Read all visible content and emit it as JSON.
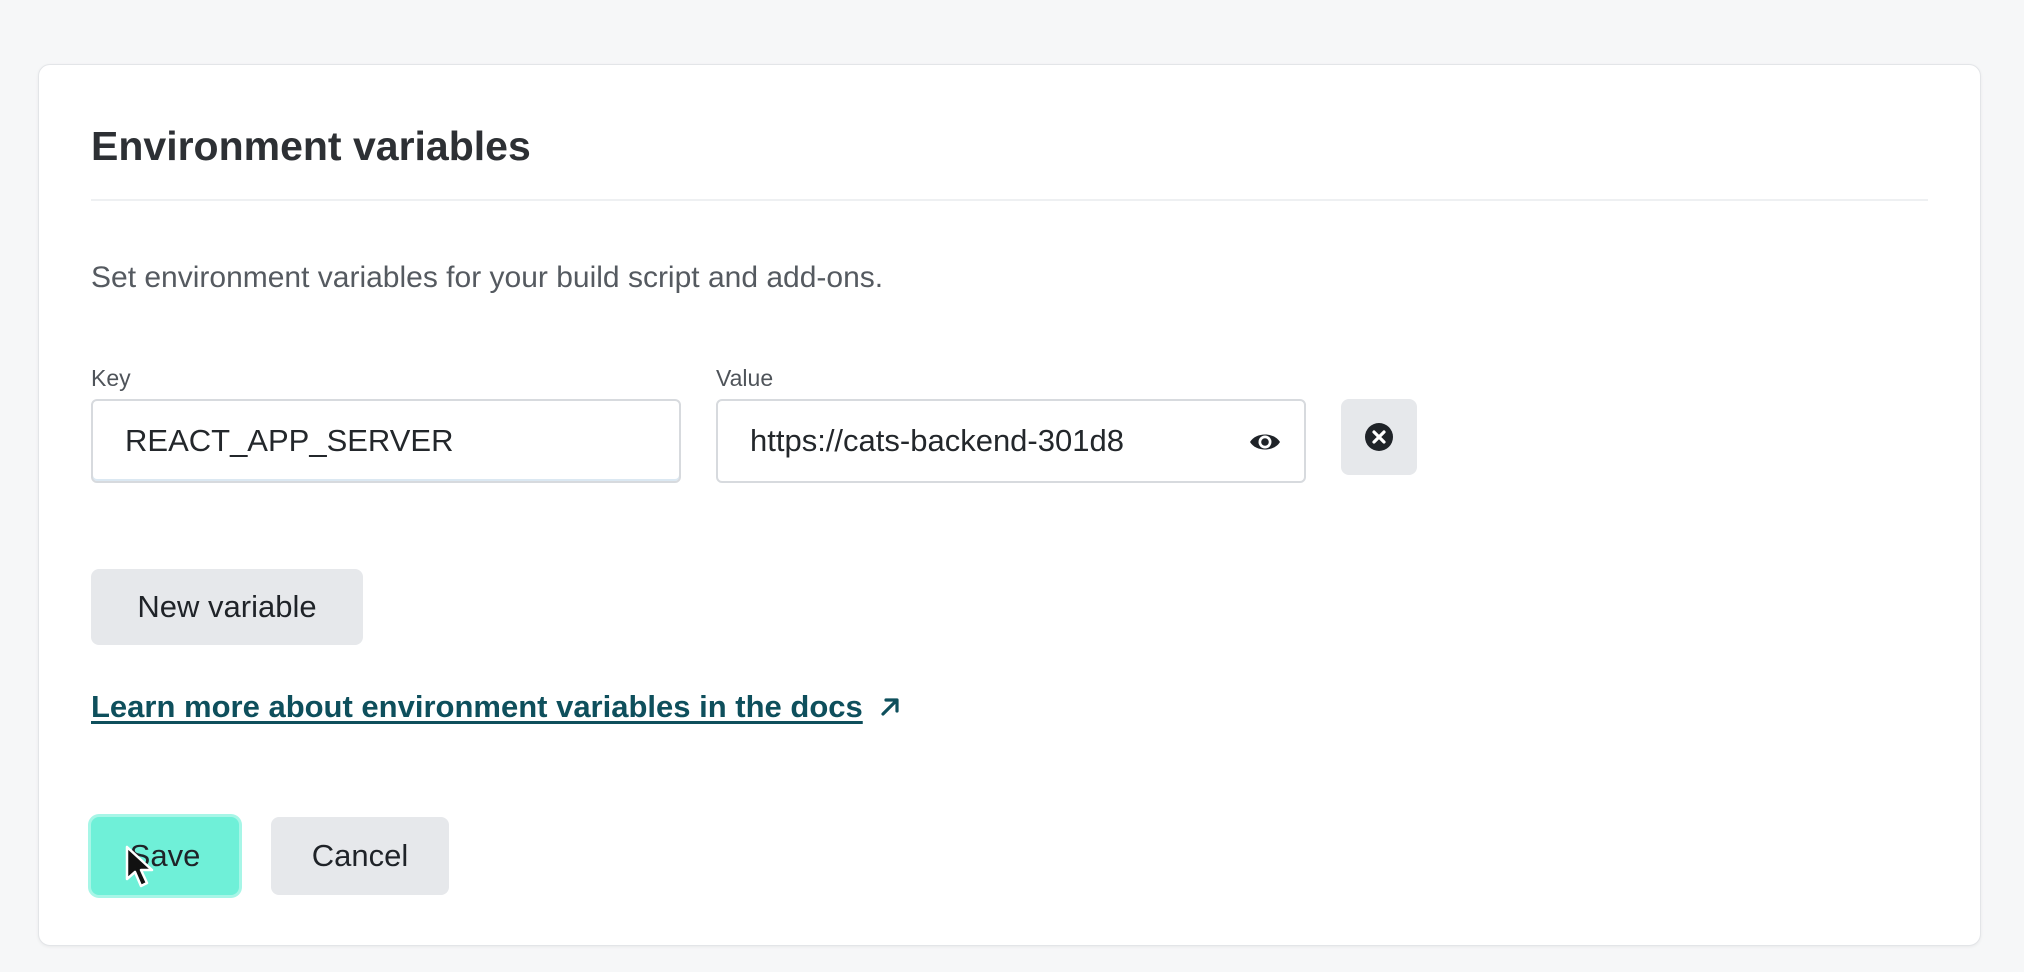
{
  "card": {
    "title": "Environment variables",
    "description": "Set environment variables for your build script and add-ons."
  },
  "variables": [
    {
      "key_label": "Key",
      "key_value": "REACT_APP_SERVER",
      "value_label": "Value",
      "value_value": "https://cats-backend-301d8",
      "value_visible": true,
      "toggle_icon": "eye-icon",
      "remove_icon": "close-circle-icon"
    }
  ],
  "actions": {
    "new_variable_label": "New variable",
    "docs_link_label": "Learn more about environment variables in the docs",
    "docs_link_icon": "arrow-up-right-icon",
    "save_label": "Save",
    "cancel_label": "Cancel"
  },
  "colors": {
    "accent": "#6ff0d8",
    "link": "#0e4f5c",
    "secondary_button": "#e6e8eb"
  }
}
